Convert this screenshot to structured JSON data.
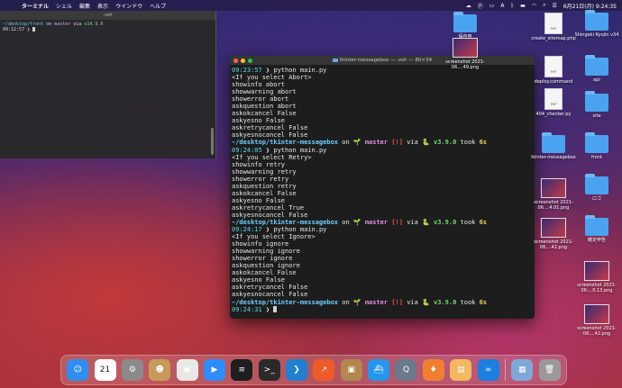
{
  "menubar": {
    "app": "ターミナル",
    "items": [
      "シェル",
      "編集",
      "表示",
      "ウインドウ",
      "ヘルプ"
    ],
    "datetime": "6月21日(月) 9:24:35"
  },
  "small_terminal": {
    "title": "-zsh",
    "line1_dir": "~/desktop/front",
    "line1_on": " on ",
    "line1_branch": "master",
    "line1_via": " via ",
    "line1_ver": "v14.9.0",
    "line2": "09:12:57 ❯ "
  },
  "terminal": {
    "title": "tkinter-messagebox — -zsh — 80×34",
    "blocks": [
      {
        "prompt_time": "09:23:57",
        "cmd": "python main.py",
        "lines": [
          "<If you select Abort>",
          "showinfo abort",
          "showwarning abort",
          "showerror abort",
          "askquestion abort",
          "askokcancel False",
          "askyesno False",
          "askretrycancel False",
          "askyesnocancel False"
        ],
        "dir": "~/desktop/tkinter-messagebox",
        "branch": "master",
        "warn": "[!]",
        "ver": "v3.9.0",
        "took": "6s"
      },
      {
        "prompt_time": "09:24:05",
        "cmd": "python main.py",
        "lines": [
          "<If you select Retry>",
          "showinfo retry",
          "showwarning retry",
          "showerror retry",
          "askquestion retry",
          "askokcancel False",
          "askyesno False",
          "askretrycancel True",
          "askyesnocancel False"
        ],
        "dir": "~/desktop/tkinter-messagebox",
        "branch": "master",
        "warn": "[!]",
        "ver": "v3.9.0",
        "took": "6s"
      },
      {
        "prompt_time": "09:24:17",
        "cmd": "python main.py",
        "lines": [
          "<If you select Ignore>",
          "showinfo ignore",
          "showwarning ignore",
          "showerror ignore",
          "askquestion ignore",
          "askokcancel False",
          "askyesno False",
          "askretrycancel False",
          "askyesnocancel False"
        ],
        "dir": "~/desktop/tkinter-messagebox",
        "branch": "master",
        "warn": "[!]",
        "ver": "v3.9.0",
        "took": "6s"
      }
    ],
    "final_time": "09:24:31",
    "on": " on ",
    "via": " via ",
    "took_word": " took ",
    "prompt_arrow": " ❯ "
  },
  "desktop": {
    "col1": [
      {
        "label": "保存用",
        "kind": "folder"
      },
      {
        "label": "screenshot 2021-06....49.png",
        "kind": "thumb"
      },
      {
        "label": "",
        "kind": "none"
      },
      {
        "label": "",
        "kind": "none"
      }
    ],
    "col2": [
      {
        "label": "create_sitemap.php",
        "kind": "doc"
      },
      {
        "label": "deploy.command",
        "kind": "doc"
      },
      {
        "label": "404_checker.py",
        "kind": "doc"
      },
      {
        "label": "tkinter-messagebox",
        "kind": "folder"
      },
      {
        "label": "screenshot 2021-06....4.01.png",
        "kind": "thumb"
      },
      {
        "label": "screenshot 2021-06....42.png",
        "kind": "thumb"
      }
    ],
    "col3": [
      {
        "label": "Shingeki Kyojin v34",
        "kind": "folder"
      },
      {
        "label": "api",
        "kind": "folder"
      },
      {
        "label": "site",
        "kind": "folder"
      },
      {
        "label": "front",
        "kind": "folder"
      },
      {
        "label": "ロゴ",
        "kind": "folder"
      },
      {
        "label": "確定申告",
        "kind": "folder"
      },
      {
        "label": "screenshot 2021-06....0.13.png",
        "kind": "thumb"
      },
      {
        "label": "screenshot 2021-06....42.png",
        "kind": "thumb"
      }
    ]
  },
  "dock": {
    "icons": [
      {
        "name": "finder-icon",
        "glyph": "☺",
        "color": "#2f8ef0"
      },
      {
        "name": "calendar-icon",
        "glyph": "21",
        "color": "#ffffff"
      },
      {
        "name": "system-preferences-icon",
        "glyph": "⚙",
        "color": "#8a8a8a"
      },
      {
        "name": "contacts-icon",
        "glyph": "☻",
        "color": "#c89a5a"
      },
      {
        "name": "chrome-icon",
        "glyph": "◉",
        "color": "#e8e8e8"
      },
      {
        "name": "zoom-icon",
        "glyph": "▶",
        "color": "#2d8cff"
      },
      {
        "name": "activity-monitor-icon",
        "glyph": "≡",
        "color": "#1e1e1e"
      },
      {
        "name": "terminal-icon",
        "glyph": ">_",
        "color": "#2a2a2a"
      },
      {
        "name": "vscode-icon",
        "glyph": "❯",
        "color": "#1f7fd0"
      },
      {
        "name": "stats-icon",
        "glyph": "↗",
        "color": "#ee5a2a"
      },
      {
        "name": "archive-icon",
        "glyph": "▣",
        "color": "#b08850"
      },
      {
        "name": "docker-icon",
        "glyph": "⛴",
        "color": "#2496ed"
      },
      {
        "name": "quicktime-icon",
        "glyph": "Q",
        "color": "#6a7a8a"
      },
      {
        "name": "sourcetree-icon",
        "glyph": "♦",
        "color": "#f08030"
      },
      {
        "name": "preview-icon",
        "glyph": "▤",
        "color": "#f4b860"
      },
      {
        "name": "infinity-icon",
        "glyph": "∞",
        "color": "#1a7fe0"
      },
      {
        "name": "screenshots-folder-icon",
        "glyph": "▦",
        "color": "#7ea8d8"
      },
      {
        "name": "trash-icon",
        "glyph": "🗑",
        "color": "#9a9a9a"
      }
    ]
  }
}
